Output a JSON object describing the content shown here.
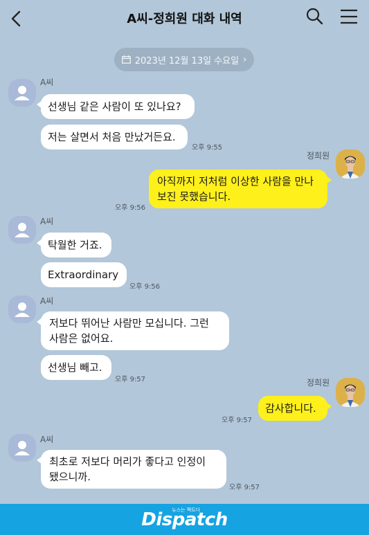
{
  "header": {
    "title": "A씨-정희원 대화 내역",
    "back_icon": "chevron-left-icon",
    "search_icon": "search-icon",
    "menu_icon": "hamburger-menu-icon"
  },
  "date_divider": {
    "label": "2023년 12월 13일 수요일",
    "arrow": "›"
  },
  "participants": {
    "other": "A씨",
    "me": "정희원"
  },
  "messages": [
    {
      "sender": "A씨",
      "text": "선생님 같은 사람이 또 있나요?"
    },
    {
      "sender": "A씨",
      "text": "저는 살면서 처음 만났거든요.",
      "time": "오후 9:55"
    },
    {
      "sender": "정희원",
      "text": "아직까지 저처럼 이상한 사람을 만나 보진 못했습니다.",
      "time": "오후 9:56"
    },
    {
      "sender": "A씨",
      "text": "탁월한 거죠."
    },
    {
      "sender": "A씨",
      "text": "Extraordinary",
      "time": "오후 9:56"
    },
    {
      "sender": "A씨",
      "text": "저보다 뛰어난 사람만 모십니다. 그런 사람은 없어요."
    },
    {
      "sender": "A씨",
      "text": "선생님 빼고.",
      "time": "오후 9:57"
    },
    {
      "sender": "정희원",
      "text": "감사합니다.",
      "time": "오후 9:57"
    },
    {
      "sender": "A씨",
      "text": "최초로 저보다 머리가 좋다고 인정이 됐으니까.",
      "time": "오후 9:57"
    }
  ],
  "footer": {
    "logo": "Dispatch",
    "logo_sub": "뉴스는 팩트다"
  },
  "colors": {
    "background": "#b2c7d9",
    "my_bubble": "#fef01b",
    "other_bubble": "#ffffff",
    "footer": "#16a3e1"
  }
}
